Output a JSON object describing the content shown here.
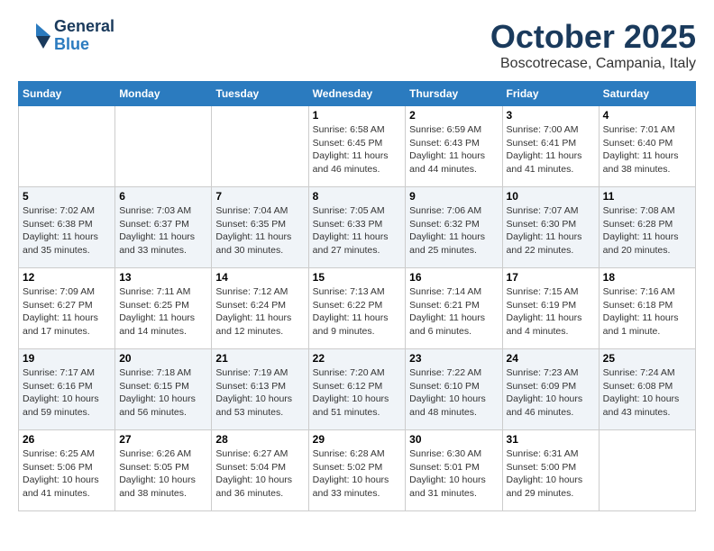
{
  "header": {
    "logo_general": "General",
    "logo_blue": "Blue",
    "month_title": "October 2025",
    "subtitle": "Boscotrecase, Campania, Italy"
  },
  "days_of_week": [
    "Sunday",
    "Monday",
    "Tuesday",
    "Wednesday",
    "Thursday",
    "Friday",
    "Saturday"
  ],
  "weeks": [
    [
      {
        "day": "",
        "info": ""
      },
      {
        "day": "",
        "info": ""
      },
      {
        "day": "",
        "info": ""
      },
      {
        "day": "1",
        "info": "Sunrise: 6:58 AM\nSunset: 6:45 PM\nDaylight: 11 hours\nand 46 minutes."
      },
      {
        "day": "2",
        "info": "Sunrise: 6:59 AM\nSunset: 6:43 PM\nDaylight: 11 hours\nand 44 minutes."
      },
      {
        "day": "3",
        "info": "Sunrise: 7:00 AM\nSunset: 6:41 PM\nDaylight: 11 hours\nand 41 minutes."
      },
      {
        "day": "4",
        "info": "Sunrise: 7:01 AM\nSunset: 6:40 PM\nDaylight: 11 hours\nand 38 minutes."
      }
    ],
    [
      {
        "day": "5",
        "info": "Sunrise: 7:02 AM\nSunset: 6:38 PM\nDaylight: 11 hours\nand 35 minutes."
      },
      {
        "day": "6",
        "info": "Sunrise: 7:03 AM\nSunset: 6:37 PM\nDaylight: 11 hours\nand 33 minutes."
      },
      {
        "day": "7",
        "info": "Sunrise: 7:04 AM\nSunset: 6:35 PM\nDaylight: 11 hours\nand 30 minutes."
      },
      {
        "day": "8",
        "info": "Sunrise: 7:05 AM\nSunset: 6:33 PM\nDaylight: 11 hours\nand 27 minutes."
      },
      {
        "day": "9",
        "info": "Sunrise: 7:06 AM\nSunset: 6:32 PM\nDaylight: 11 hours\nand 25 minutes."
      },
      {
        "day": "10",
        "info": "Sunrise: 7:07 AM\nSunset: 6:30 PM\nDaylight: 11 hours\nand 22 minutes."
      },
      {
        "day": "11",
        "info": "Sunrise: 7:08 AM\nSunset: 6:28 PM\nDaylight: 11 hours\nand 20 minutes."
      }
    ],
    [
      {
        "day": "12",
        "info": "Sunrise: 7:09 AM\nSunset: 6:27 PM\nDaylight: 11 hours\nand 17 minutes."
      },
      {
        "day": "13",
        "info": "Sunrise: 7:11 AM\nSunset: 6:25 PM\nDaylight: 11 hours\nand 14 minutes."
      },
      {
        "day": "14",
        "info": "Sunrise: 7:12 AM\nSunset: 6:24 PM\nDaylight: 11 hours\nand 12 minutes."
      },
      {
        "day": "15",
        "info": "Sunrise: 7:13 AM\nSunset: 6:22 PM\nDaylight: 11 hours\nand 9 minutes."
      },
      {
        "day": "16",
        "info": "Sunrise: 7:14 AM\nSunset: 6:21 PM\nDaylight: 11 hours\nand 6 minutes."
      },
      {
        "day": "17",
        "info": "Sunrise: 7:15 AM\nSunset: 6:19 PM\nDaylight: 11 hours\nand 4 minutes."
      },
      {
        "day": "18",
        "info": "Sunrise: 7:16 AM\nSunset: 6:18 PM\nDaylight: 11 hours\nand 1 minute."
      }
    ],
    [
      {
        "day": "19",
        "info": "Sunrise: 7:17 AM\nSunset: 6:16 PM\nDaylight: 10 hours\nand 59 minutes."
      },
      {
        "day": "20",
        "info": "Sunrise: 7:18 AM\nSunset: 6:15 PM\nDaylight: 10 hours\nand 56 minutes."
      },
      {
        "day": "21",
        "info": "Sunrise: 7:19 AM\nSunset: 6:13 PM\nDaylight: 10 hours\nand 53 minutes."
      },
      {
        "day": "22",
        "info": "Sunrise: 7:20 AM\nSunset: 6:12 PM\nDaylight: 10 hours\nand 51 minutes."
      },
      {
        "day": "23",
        "info": "Sunrise: 7:22 AM\nSunset: 6:10 PM\nDaylight: 10 hours\nand 48 minutes."
      },
      {
        "day": "24",
        "info": "Sunrise: 7:23 AM\nSunset: 6:09 PM\nDaylight: 10 hours\nand 46 minutes."
      },
      {
        "day": "25",
        "info": "Sunrise: 7:24 AM\nSunset: 6:08 PM\nDaylight: 10 hours\nand 43 minutes."
      }
    ],
    [
      {
        "day": "26",
        "info": "Sunrise: 6:25 AM\nSunset: 5:06 PM\nDaylight: 10 hours\nand 41 minutes."
      },
      {
        "day": "27",
        "info": "Sunrise: 6:26 AM\nSunset: 5:05 PM\nDaylight: 10 hours\nand 38 minutes."
      },
      {
        "day": "28",
        "info": "Sunrise: 6:27 AM\nSunset: 5:04 PM\nDaylight: 10 hours\nand 36 minutes."
      },
      {
        "day": "29",
        "info": "Sunrise: 6:28 AM\nSunset: 5:02 PM\nDaylight: 10 hours\nand 33 minutes."
      },
      {
        "day": "30",
        "info": "Sunrise: 6:30 AM\nSunset: 5:01 PM\nDaylight: 10 hours\nand 31 minutes."
      },
      {
        "day": "31",
        "info": "Sunrise: 6:31 AM\nSunset: 5:00 PM\nDaylight: 10 hours\nand 29 minutes."
      },
      {
        "day": "",
        "info": ""
      }
    ]
  ]
}
